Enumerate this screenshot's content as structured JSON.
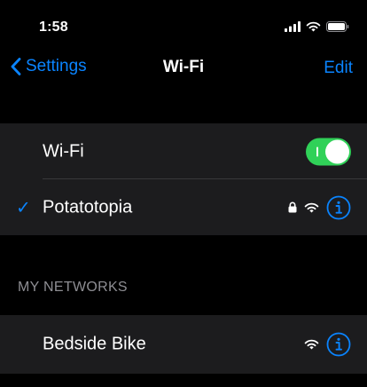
{
  "status_bar": {
    "time": "1:58",
    "icons": [
      "signal-icon",
      "wifi-icon",
      "battery-icon"
    ]
  },
  "nav": {
    "back_label": "Settings",
    "title": "Wi-Fi",
    "edit_label": "Edit"
  },
  "wifi_toggle": {
    "label": "Wi-Fi",
    "on": true
  },
  "connected_network": {
    "check": "✓",
    "name": "Potatotopia",
    "secured": true,
    "icons": [
      "lock-icon",
      "wifi-icon",
      "info-icon"
    ]
  },
  "my_networks": {
    "header": "MY NETWORKS",
    "items": [
      {
        "name": "Bedside Bike",
        "secured": false,
        "icons": [
          "wifi-icon",
          "info-icon"
        ]
      }
    ]
  },
  "colors": {
    "background": "#000000",
    "group_background": "#1c1c1e",
    "accent": "#0a84ff",
    "toggle_on": "#30d158",
    "secondary_text": "#8e8e93",
    "divider": "#38383a"
  }
}
